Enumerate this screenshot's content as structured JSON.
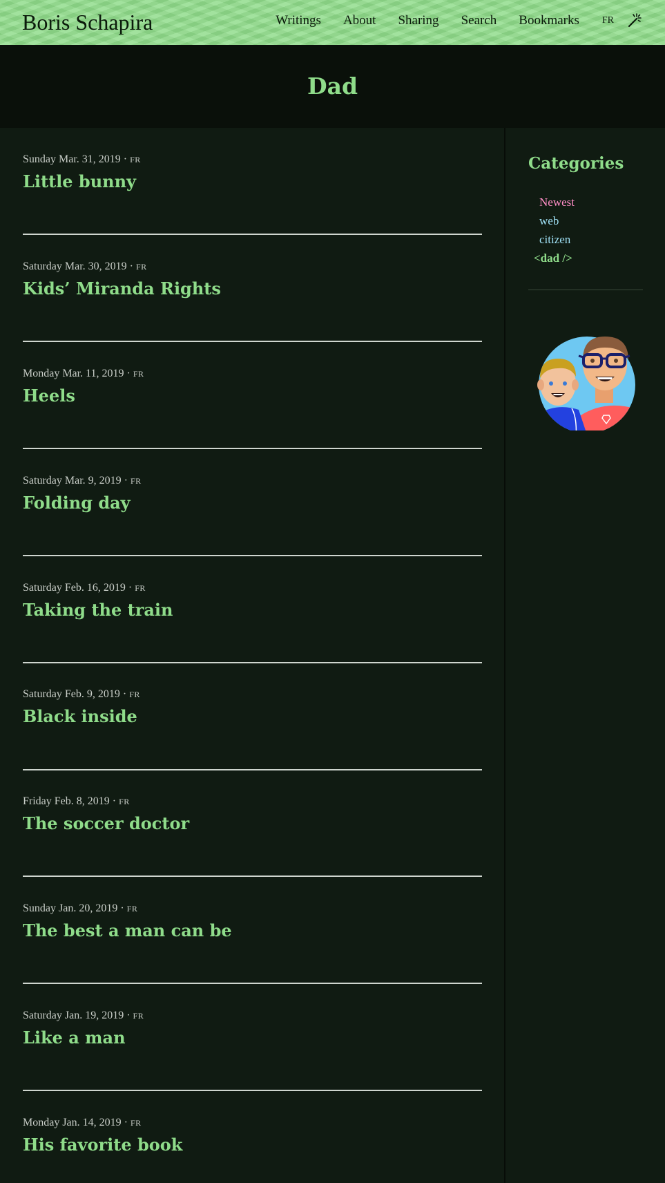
{
  "site": {
    "title": "Boris Schapira"
  },
  "nav": {
    "items": [
      "Writings",
      "About",
      "Sharing",
      "Search",
      "Bookmarks"
    ],
    "lang": "FR",
    "theme_icon": "magic-wand-icon"
  },
  "page": {
    "heading": "Dad"
  },
  "posts": [
    {
      "date": "Sunday Mar. 31, 2019 · ",
      "lang": "FR",
      "title": "Little bunny"
    },
    {
      "date": "Saturday Mar. 30, 2019 · ",
      "lang": "FR",
      "title": "Kids’ Miranda Rights"
    },
    {
      "date": "Monday Mar. 11, 2019 · ",
      "lang": "FR",
      "title": "Heels"
    },
    {
      "date": "Saturday Mar. 9, 2019 · ",
      "lang": "FR",
      "title": "Folding day"
    },
    {
      "date": "Saturday Feb. 16, 2019 · ",
      "lang": "FR",
      "title": "Taking the train"
    },
    {
      "date": "Saturday Feb. 9, 2019 · ",
      "lang": "FR",
      "title": "Black inside"
    },
    {
      "date": "Friday Feb. 8, 2019 · ",
      "lang": "FR",
      "title": "The soccer doctor"
    },
    {
      "date": "Sunday Jan. 20, 2019 · ",
      "lang": "FR",
      "title": "The best a man can be"
    },
    {
      "date": "Saturday Jan. 19, 2019 · ",
      "lang": "FR",
      "title": "Like a man"
    },
    {
      "date": "Monday Jan. 14, 2019 · ",
      "lang": "FR",
      "title": "His favorite book"
    }
  ],
  "sidebar": {
    "heading": "Categories",
    "categories": [
      {
        "label": "Newest",
        "color": "#ff8ec7"
      },
      {
        "label": "web",
        "color": "#9fe0f5"
      },
      {
        "label": "citizen",
        "color": "#9fe0f5"
      },
      {
        "label": "<dad />",
        "color": "#8fdc8a"
      }
    ],
    "avatar_icon": "father-and-son-avatar"
  },
  "colors": {
    "accent": "#8fdc8a",
    "header_bg": "#8fdc8a",
    "body_bg": "#101b12",
    "hero_bg": "#0a100a"
  }
}
